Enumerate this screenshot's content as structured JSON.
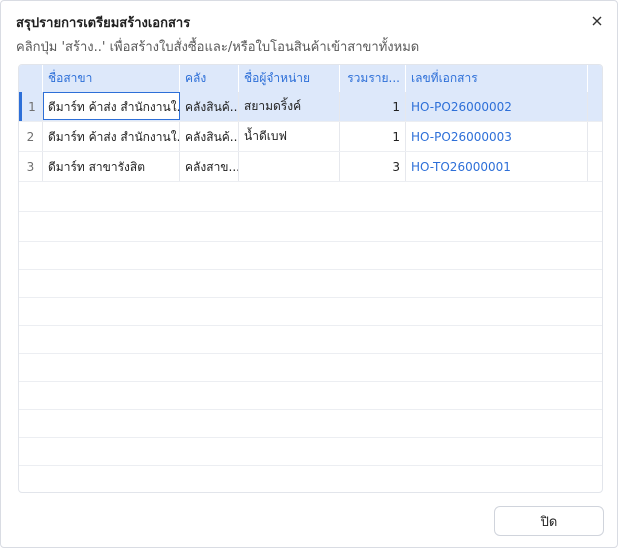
{
  "dialog": {
    "title": "สรุปรายการเตรียมสร้างเอกสาร",
    "subtitle": "คลิกปุ่ม 'สร้าง..' เพื่อสร้างใบสั่งซื้อและ/หรือใบโอนสินค้าเข้าสาขาทั้งหมด",
    "close_icon": "close-icon",
    "close_button_label": "ปิด"
  },
  "table": {
    "columns": [
      "ชื่อสาขา",
      "คลัง",
      "ชื่อผู้จำหน่าย",
      "รวมราย...",
      "เลขที่เอกสาร"
    ],
    "rows": [
      {
        "no": "1",
        "branch": "ดีมาร์ท ค้าส่ง สำนักงานใ...",
        "warehouse": "คลังสินค้...",
        "vendor": "สยามดริ้งค์",
        "total": "1",
        "doc_no": "HO-PO26000002"
      },
      {
        "no": "2",
        "branch": "ดีมาร์ท ค้าส่ง สำนักงานใ...",
        "warehouse": "คลังสินค้...",
        "vendor": "น้ำดีเบฟ",
        "total": "1",
        "doc_no": "HO-PO26000003"
      },
      {
        "no": "3",
        "branch": "ดีมาร์ท สาขารังสิต",
        "warehouse": "คลังสาข...",
        "vendor": "",
        "total": "3",
        "doc_no": "HO-TO26000001"
      }
    ],
    "selected_row": 1
  },
  "colors": {
    "accent": "#2d6fd8",
    "header_bg": "#dde8fa",
    "border": "#e2e5eb"
  }
}
